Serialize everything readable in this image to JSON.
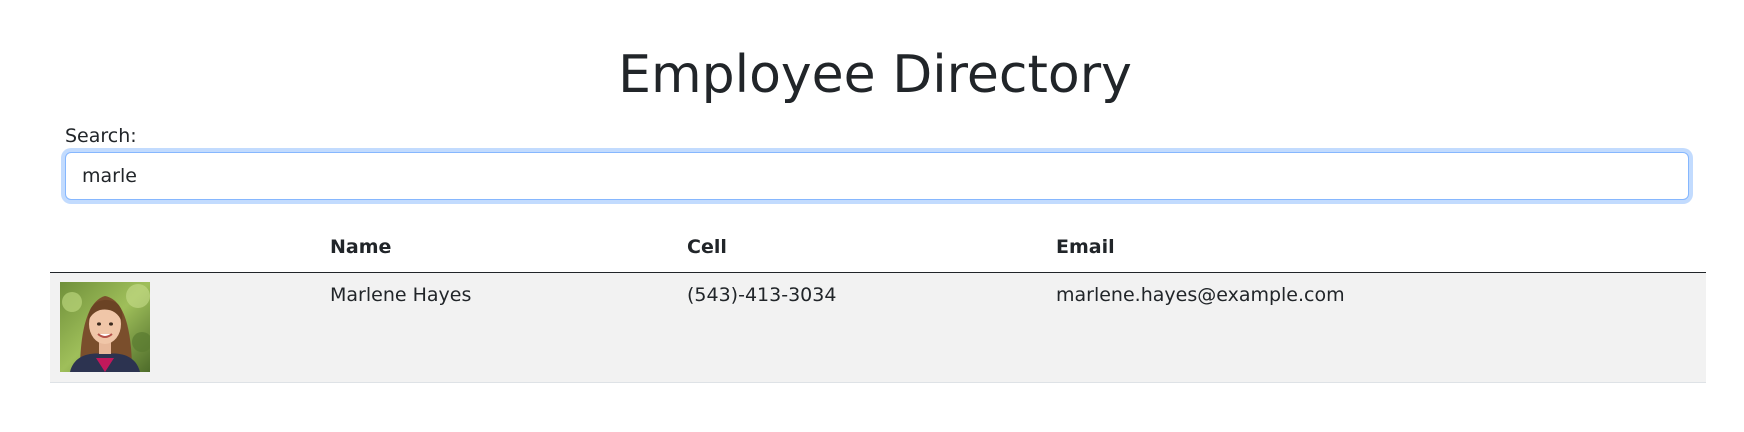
{
  "page": {
    "title": "Employee Directory"
  },
  "search": {
    "label": "Search:",
    "value": "marle",
    "placeholder": ""
  },
  "table": {
    "columns": [
      "",
      "Name",
      "Cell",
      "Email"
    ],
    "rows": [
      {
        "photo": "employee-photo-icon",
        "name": "Marlene Hayes",
        "cell": "(543)-413-3034",
        "email": "marlene.hayes@example.com"
      }
    ]
  },
  "colors": {
    "focus_border": "#86b7fe",
    "row_background": "#f2f2f2",
    "text": "#212529"
  }
}
